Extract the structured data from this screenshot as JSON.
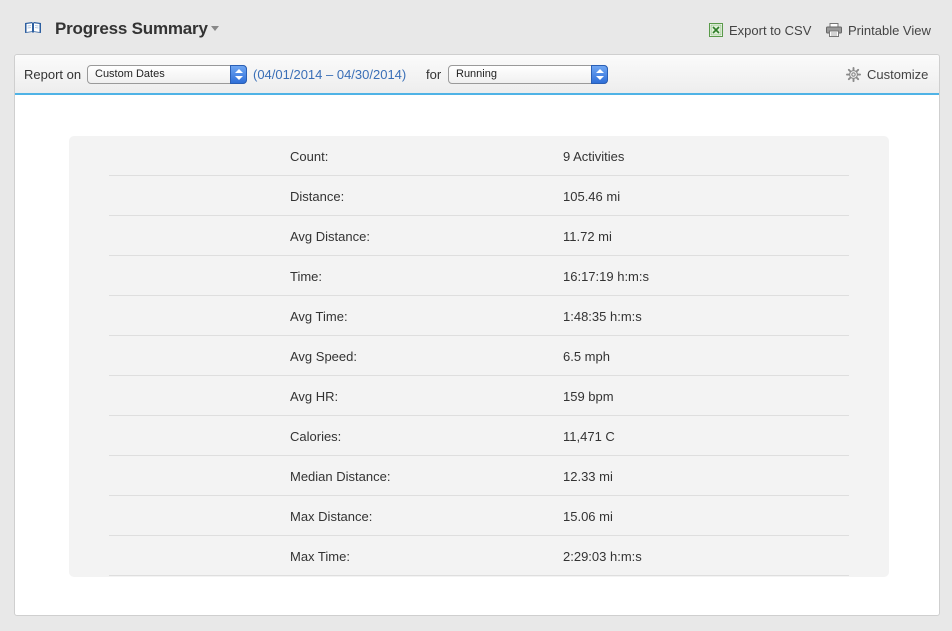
{
  "header": {
    "title": "Progress Summary",
    "export_label": "Export to CSV",
    "printable_label": "Printable View"
  },
  "toolbar": {
    "report_on_label": "Report on",
    "date_select_value": "Custom Dates",
    "date_range": "(04/01/2014 – 04/30/2014)",
    "for_label": "for",
    "activity_select_value": "Running",
    "customize_label": "Customize"
  },
  "summary": {
    "rows": [
      {
        "label": "Count:",
        "value": "9 Activities"
      },
      {
        "label": "Distance:",
        "value": "105.46 mi"
      },
      {
        "label": "Avg Distance:",
        "value": "11.72 mi"
      },
      {
        "label": "Time:",
        "value": "16:17:19 h:m:s"
      },
      {
        "label": "Avg Time:",
        "value": "1:48:35 h:m:s"
      },
      {
        "label": "Avg Speed:",
        "value": "6.5 mph"
      },
      {
        "label": "Avg HR:",
        "value": "159 bpm"
      },
      {
        "label": "Calories:",
        "value": "11,471 C"
      },
      {
        "label": "Median Distance:",
        "value": "12.33 mi"
      },
      {
        "label": "Max Distance:",
        "value": "15.06 mi"
      },
      {
        "label": "Max Time:",
        "value": "2:29:03 h:m:s"
      }
    ]
  },
  "colors": {
    "accent": "#4fb3e6",
    "link": "#3a6fb7",
    "select_arrow": "#2f6fd8"
  },
  "icons": [
    "book-icon",
    "title-dropdown-icon",
    "excel-icon",
    "printer-icon",
    "gear-icon"
  ]
}
